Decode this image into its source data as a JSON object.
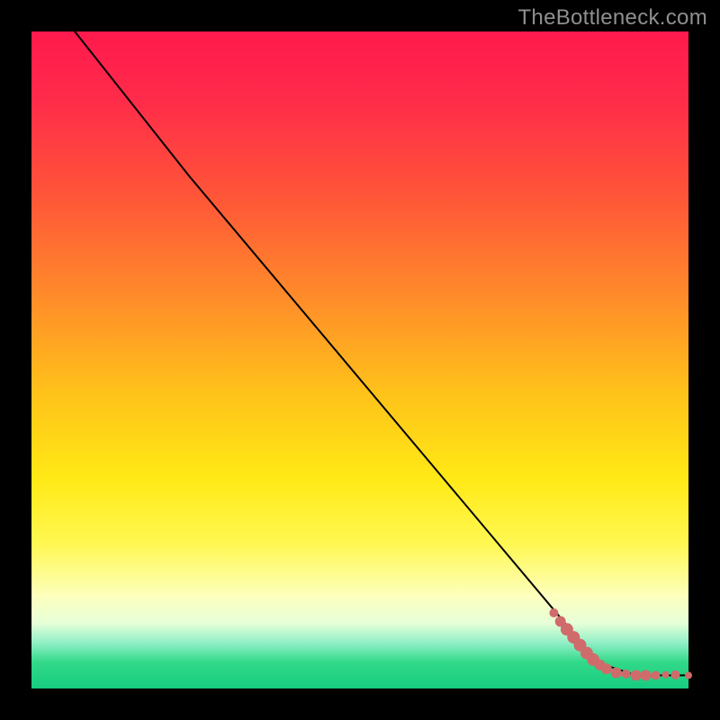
{
  "watermark": "TheBottleneck.com",
  "chart_data": {
    "type": "line",
    "title": "",
    "xlabel": "",
    "ylabel": "",
    "xlim": [
      0,
      100
    ],
    "ylim": [
      0,
      100
    ],
    "curve": [
      {
        "x": 5.0,
        "y": 102.0
      },
      {
        "x": 24.0,
        "y": 78.0
      },
      {
        "x": 82.0,
        "y": 9.0
      },
      {
        "x": 86.0,
        "y": 4.0
      },
      {
        "x": 92.0,
        "y": 2.0
      },
      {
        "x": 100.0,
        "y": 2.0
      }
    ],
    "series": [
      {
        "name": "points",
        "color": "#d06b6b",
        "values": [
          {
            "x": 79.5,
            "y": 11.5,
            "r": 5
          },
          {
            "x": 80.5,
            "y": 10.2,
            "r": 6
          },
          {
            "x": 81.5,
            "y": 9.0,
            "r": 7
          },
          {
            "x": 82.5,
            "y": 7.8,
            "r": 7
          },
          {
            "x": 83.5,
            "y": 6.6,
            "r": 7
          },
          {
            "x": 84.5,
            "y": 5.4,
            "r": 7
          },
          {
            "x": 85.5,
            "y": 4.4,
            "r": 7
          },
          {
            "x": 86.5,
            "y": 3.6,
            "r": 6
          },
          {
            "x": 87.5,
            "y": 3.0,
            "r": 6
          },
          {
            "x": 89.0,
            "y": 2.4,
            "r": 6
          },
          {
            "x": 90.5,
            "y": 2.2,
            "r": 5
          },
          {
            "x": 92.0,
            "y": 2.0,
            "r": 6
          },
          {
            "x": 93.5,
            "y": 2.0,
            "r": 6
          },
          {
            "x": 95.0,
            "y": 2.0,
            "r": 5
          },
          {
            "x": 96.5,
            "y": 2.1,
            "r": 4
          },
          {
            "x": 98.0,
            "y": 2.1,
            "r": 5
          },
          {
            "x": 100.0,
            "y": 2.0,
            "r": 4
          }
        ]
      }
    ]
  }
}
